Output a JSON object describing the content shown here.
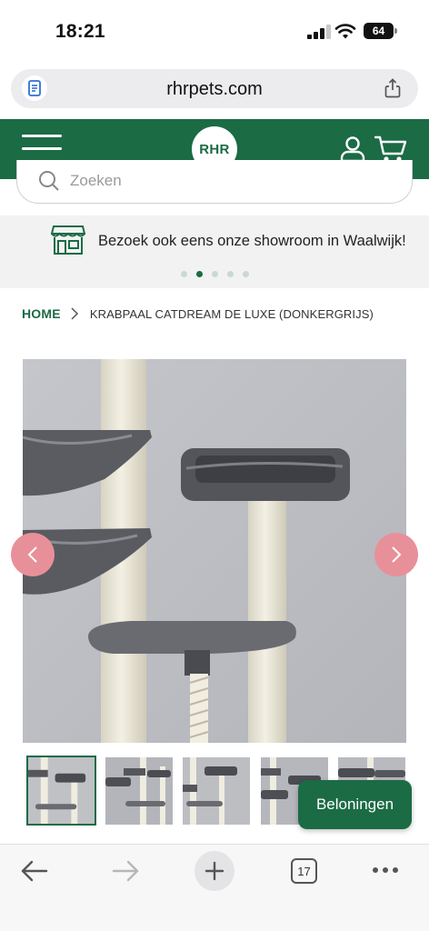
{
  "status_bar": {
    "time": "18:21",
    "battery": "64"
  },
  "browser": {
    "url": "rhrpets.com",
    "tab_count": "17"
  },
  "site": {
    "logo_text": "RHR",
    "search_placeholder": "Zoeken",
    "banner_text": "Bezoek ook eens onze showroom in Waalwijk!",
    "banner_slide_count": 5,
    "banner_active_slide": 2
  },
  "breadcrumb": {
    "home": "HOME",
    "current": "KRABPAAL CATDREAM DE LUXE (DONKERGRIJS)"
  },
  "gallery": {
    "thumbnail_count": 5,
    "active_thumbnail": 1
  },
  "rewards_button": "Beloningen",
  "colors": {
    "brand_green": "#1b6b45",
    "arrow_pink": "#e8909a",
    "banner_bg": "#f2f2f2"
  },
  "icons": [
    "document-icon",
    "share-icon",
    "menu-icon",
    "account-icon",
    "cart-icon",
    "search-icon",
    "store-icon",
    "chevron-right-icon",
    "arrow-left-icon",
    "arrow-right-icon",
    "plus-icon",
    "tabs-icon",
    "more-icon"
  ]
}
